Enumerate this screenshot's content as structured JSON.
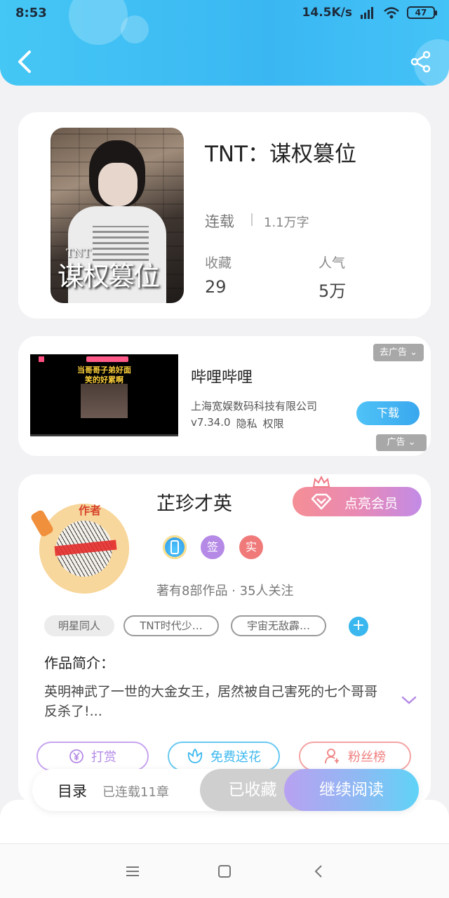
{
  "status_bar": {
    "time": "8:53",
    "network_speed": "14.5K/s",
    "battery": "47"
  },
  "book": {
    "title": "TNT：谋权篡位",
    "cover_title": "谋权篡位",
    "cover_tnt": "TNT",
    "status": "连载",
    "word_count": "1.1万字",
    "favorites_label": "收藏",
    "favorites_value": "29",
    "popularity_label": "人气",
    "popularity_value": "5万"
  },
  "ad": {
    "app_name": "哔哩哔哩",
    "company": "上海宽娱数码科技有限公司",
    "version": "v7.34.0",
    "privacy": "隐私",
    "permissions": "权限",
    "download_label": "下载",
    "remove_label": "去广告 ⌄",
    "ad_label": "广告 ⌄",
    "video_caption_1": "当哥哥子弟好面",
    "video_caption_2": "笑的好累啊"
  },
  "author": {
    "name": "芷珍才英",
    "avatar_badge": "作者",
    "vip_label": "点亮会员",
    "badges": [
      {
        "label": "",
        "color": "#3ab2ee"
      },
      {
        "label": "签",
        "color": "#b589e6"
      },
      {
        "label": "实",
        "color": "#f07a7a"
      }
    ],
    "stats": "著有8部作品 · 35人关注"
  },
  "tags": [
    "明星同人",
    "TNT时代少…",
    "宇宙无敌霹…"
  ],
  "intro": {
    "title": "作品简介：",
    "text": "英明神武了一世的大金女王，居然被自己害死的七个哥哥反杀了!..."
  },
  "actions": {
    "reward": "打赏",
    "flower": "免费送花",
    "fans": "粉丝榜"
  },
  "colors": {
    "reward": "#b48ae6",
    "flower": "#3db8ee",
    "fans": "#f08080"
  },
  "bottom_bar": {
    "toc": "目录",
    "chapters": "已连载11章",
    "collected": "已收藏",
    "continue": "继续阅读"
  }
}
